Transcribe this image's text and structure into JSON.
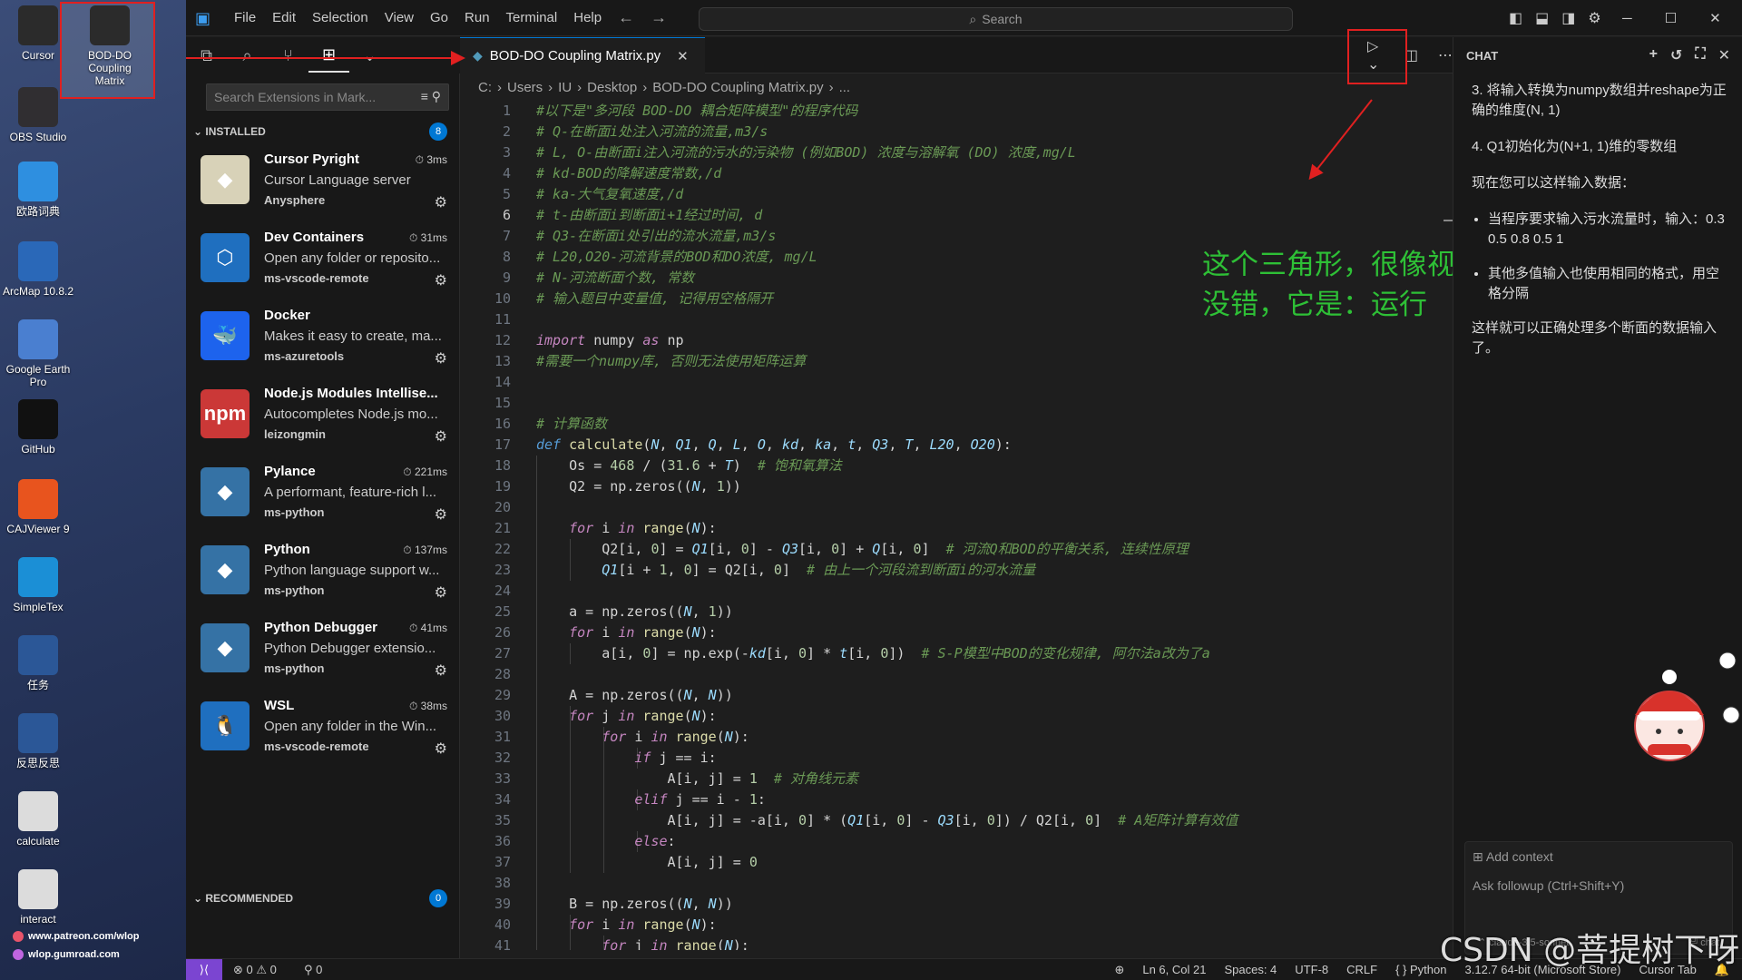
{
  "desktop": {
    "icons": [
      {
        "label": "Cursor",
        "icon": "cursor-app-icon",
        "color": "#2b2b2b"
      },
      {
        "label": "BOD-DO Coupling Matrix",
        "icon": "python-file-icon",
        "color": "#2b2b2b"
      },
      {
        "label": "OBS Studio",
        "icon": "obs-icon",
        "color": "#302e31"
      },
      {
        "label": "欧路词典",
        "icon": "eudic-icon",
        "color": "#2e8fe0"
      },
      {
        "label": "ArcMap 10.8.2",
        "icon": "arcmap-icon",
        "color": "#2a68b8"
      },
      {
        "label": "Google Earth Pro",
        "icon": "google-earth-icon",
        "color": "#4a7fd0"
      },
      {
        "label": "GitHub",
        "icon": "github-icon",
        "color": "#111111"
      },
      {
        "label": "CAJViewer 9",
        "icon": "caj-icon",
        "color": "#e8541e"
      },
      {
        "label": "SimpleTex",
        "icon": "simpletex-icon",
        "color": "#1b8fd6"
      },
      {
        "label": "任务",
        "icon": "word-doc-icon",
        "color": "#2b5797"
      },
      {
        "label": "反思反思",
        "icon": "word-doc-icon",
        "color": "#2b5797"
      },
      {
        "label": "calculate",
        "icon": "python-file-icon",
        "color": "#dcdcdc"
      },
      {
        "label": "interact",
        "icon": "python-file-icon",
        "color": "#dcdcdc"
      }
    ],
    "links": [
      "www.patreon.com/wlop",
      "wlop.gumroad.com"
    ]
  },
  "titlebar": {
    "menu": [
      "File",
      "Edit",
      "Selection",
      "View",
      "Go",
      "Run",
      "Terminal",
      "Help"
    ],
    "search_placeholder": "Search"
  },
  "sidebar": {
    "search_placeholder": "Search Extensions in Mark...",
    "installed_label": "INSTALLED",
    "installed_count": "8",
    "recommended_label": "RECOMMENDED",
    "recommended_count": "0",
    "extensions": [
      {
        "name": "Cursor Pyright",
        "time": "3ms",
        "desc": "Cursor Language server",
        "publisher": "Anysphere",
        "icon": "cursor-pyright-icon",
        "color": "#d8d2b8"
      },
      {
        "name": "Dev Containers",
        "time": "31ms",
        "desc": "Open any folder or reposito...",
        "publisher": "ms-vscode-remote",
        "icon": "dev-containers-icon",
        "color": "#1f6fbf"
      },
      {
        "name": "Docker",
        "time": "",
        "desc": "Makes it easy to create, ma...",
        "publisher": "ms-azuretools",
        "icon": "docker-icon",
        "color": "#1d63ed"
      },
      {
        "name": "Node.js Modules Intellise...",
        "time": "",
        "desc": "Autocompletes Node.js mo...",
        "publisher": "leizongmin",
        "icon": "npm-icon",
        "color": "#cb3837"
      },
      {
        "name": "Pylance",
        "time": "221ms",
        "desc": "A performant, feature-rich l...",
        "publisher": "ms-python",
        "icon": "python-icon",
        "color": "#3572a5"
      },
      {
        "name": "Python",
        "time": "137ms",
        "desc": "Python language support w...",
        "publisher": "ms-python",
        "icon": "python-icon",
        "color": "#3572a5"
      },
      {
        "name": "Python Debugger",
        "time": "41ms",
        "desc": "Python Debugger extensio...",
        "publisher": "ms-python",
        "icon": "python-icon",
        "color": "#3572a5"
      },
      {
        "name": "WSL",
        "time": "38ms",
        "desc": "Open any folder in the Win...",
        "publisher": "ms-vscode-remote",
        "icon": "linux-penguin-icon",
        "color": "#1f6fbf"
      }
    ]
  },
  "editor": {
    "tab_label": "BOD-DO Coupling Matrix.py",
    "breadcrumb": [
      "C:",
      "Users",
      "IU",
      "Desktop",
      "BOD-DO Coupling Matrix.py",
      "..."
    ],
    "annotation": [
      "这个三角形，很像视频的播放键",
      "没错，它是：运行"
    ],
    "current_line": 6,
    "first_line": 1
  },
  "chat": {
    "title": "CHAT",
    "paragraphs_top": [
      "3. 将输入转换为numpy数组并reshape为正确的维度(N, 1)",
      "4. Q1初始化为(N+1, 1)维的零数组",
      "现在您可以这样输入数据："
    ],
    "bullets": [
      "当程序要求输入污水流量时，输入：0.3 0.5 0.8 0.5 1",
      "其他多值输入也使用相同的格式，用空格分隔"
    ],
    "closing": "这样就可以正确处理多个断面的数据输入了。",
    "add_context": "Add context",
    "followup_placeholder": "Ask followup (Ctrl+Shift+Y)",
    "model": "claude-3.5-sonnet",
    "mode": "chat"
  },
  "statusbar": {
    "errors": "0",
    "warnings": "0",
    "ports": "0",
    "cursor_pos": "Ln 6, Col 21",
    "spaces": "Spaces: 4",
    "encoding": "UTF-8",
    "eol": "CRLF",
    "language": "Python",
    "interpreter": "3.12.7 64-bit (Microsoft Store)",
    "tab_mode": "Cursor Tab"
  },
  "watermark": "CSDN @菩提树下呀"
}
